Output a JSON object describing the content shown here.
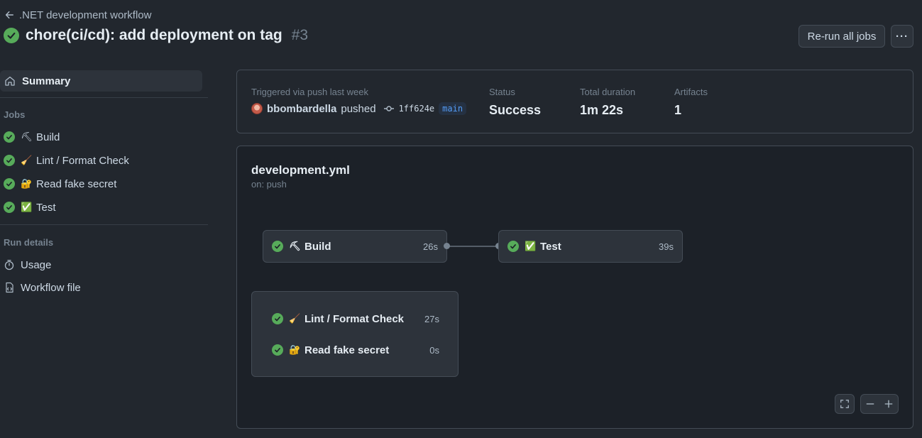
{
  "header": {
    "back_label": ".NET development workflow",
    "title": "chore(ci/cd): add deployment on tag",
    "run_number": "#3",
    "rerun_label": "Re-run all jobs",
    "more_label": "···"
  },
  "sidebar": {
    "summary_label": "Summary",
    "jobs_heading": "Jobs",
    "jobs": [
      {
        "emoji": "⛏",
        "label": "Build"
      },
      {
        "emoji": "🧹",
        "label": "Lint / Format Check"
      },
      {
        "emoji": "🔐",
        "label": "Read fake secret"
      },
      {
        "emoji": "✅",
        "label": "Test"
      }
    ],
    "run_details_heading": "Run details",
    "usage_label": "Usage",
    "workflow_file_label": "Workflow file"
  },
  "summary": {
    "trigger_label": "Triggered via push last week",
    "actor": "bbombardella",
    "action": "pushed",
    "sha": "1ff624e",
    "branch": "main",
    "status_label": "Status",
    "status_value": "Success",
    "duration_label": "Total duration",
    "duration_value": "1m 22s",
    "artifacts_label": "Artifacts",
    "artifacts_value": "1"
  },
  "workflow": {
    "file": "development.yml",
    "trigger": "on: push",
    "jobs": {
      "build": {
        "emoji": "⛏",
        "label": "Build",
        "duration": "26s"
      },
      "test": {
        "emoji": "✅",
        "label": "Test",
        "duration": "39s"
      },
      "lint": {
        "emoji": "🧹",
        "label": "Lint / Format Check",
        "duration": "27s"
      },
      "secret": {
        "emoji": "🔐",
        "label": "Read fake secret",
        "duration": "0s"
      }
    }
  },
  "colors": {
    "success": "#57ab5a",
    "background": "#22272e",
    "branch": "#539bf5"
  }
}
